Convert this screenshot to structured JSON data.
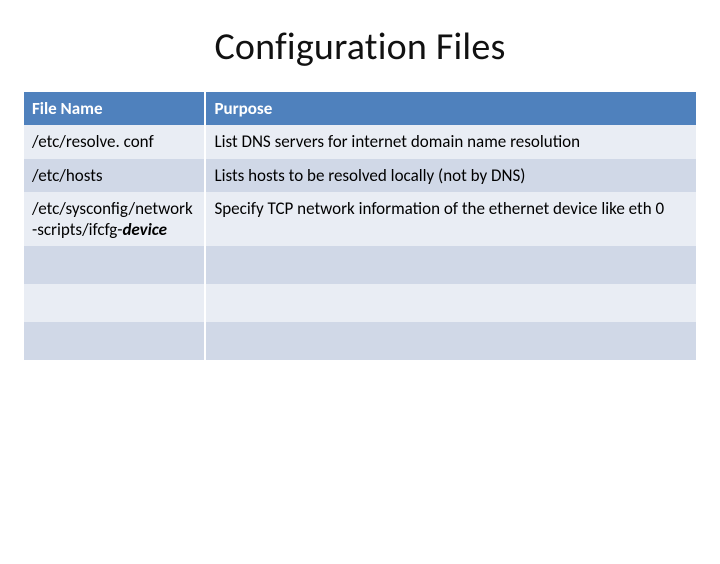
{
  "title": "Configuration Files",
  "headers": {
    "file_name": "File Name",
    "purpose": "Purpose"
  },
  "rows": [
    {
      "file_name": {
        "base": "/etc/resolve. conf",
        "em": ""
      },
      "purpose": "List DNS servers for internet domain name resolution"
    },
    {
      "file_name": {
        "base": "/etc/hosts",
        "em": ""
      },
      "purpose": "Lists hosts to be resolved locally (not by DNS)"
    },
    {
      "file_name": {
        "base": "/etc/sysconfig/network-scripts/ifcfg-",
        "em": "device"
      },
      "purpose": "Specify TCP network information of the ethernet device like eth 0"
    },
    {
      "file_name": {
        "base": "",
        "em": ""
      },
      "purpose": ""
    },
    {
      "file_name": {
        "base": "",
        "em": ""
      },
      "purpose": ""
    },
    {
      "file_name": {
        "base": "",
        "em": ""
      },
      "purpose": ""
    }
  ]
}
